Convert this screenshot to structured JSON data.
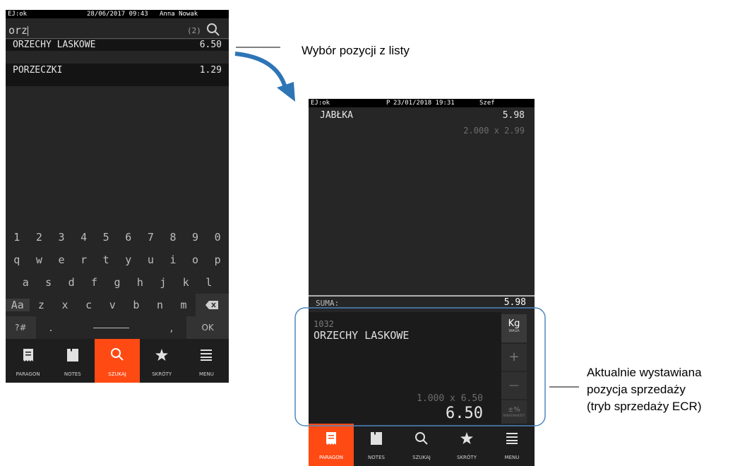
{
  "screen1": {
    "status": {
      "left": "EJ:ok",
      "datetime": "28/06/2017 09:43",
      "user": "Anna Nowak"
    },
    "search": {
      "value": "orz",
      "count": "(2)"
    },
    "results": [
      {
        "name": "ORZECHY LASKOWE",
        "price": "6.50"
      },
      {
        "name": "PORZECZKI",
        "price": "1.29"
      }
    ],
    "keyboard": {
      "row1": [
        "1",
        "2",
        "3",
        "4",
        "5",
        "6",
        "7",
        "8",
        "9",
        "0"
      ],
      "row2": [
        "q",
        "w",
        "e",
        "r",
        "t",
        "y",
        "u",
        "i",
        "o",
        "p"
      ],
      "row3": [
        "a",
        "s",
        "d",
        "f",
        "g",
        "h",
        "j",
        "k",
        "l"
      ],
      "row4": [
        "Aa",
        "z",
        "x",
        "c",
        "v",
        "b",
        "n",
        "m"
      ],
      "row5": {
        "sym": "?#",
        "dot": ".",
        "comma": ",",
        "ok": "OK"
      }
    },
    "nav": [
      "PARAGON",
      "NOTES",
      "SZUKAJ",
      "SKRÓTY",
      "MENU"
    ],
    "active_tab": "SZUKAJ"
  },
  "screen2": {
    "status": {
      "left": "EJ:ok",
      "mode": "P",
      "datetime": "23/01/2018 19:31",
      "user": "Szef"
    },
    "receipt": {
      "item": "JABŁKA",
      "price": "5.98",
      "qty_line": "2.000 x 2.99"
    },
    "sum": {
      "label": "SUMA:",
      "value": "5.98"
    },
    "current": {
      "code": "1032",
      "name": "ORZECHY LASKOWE",
      "qty_line": "1.000 x 6.50",
      "total": "6.50"
    },
    "side": {
      "kg": "Kg",
      "waga": "WAGA",
      "plus": "+",
      "minus": "—",
      "pct": "±%",
      "rabat": "RABAT/NARZUT"
    },
    "nav": [
      "PARAGON",
      "NOTES",
      "SZUKAJ",
      "SKRÓTY",
      "MENU"
    ],
    "active_tab": "PARAGON"
  },
  "annotations": {
    "top": "Wybór pozycji z listy",
    "bottom": [
      "Aktualnie wystawiana",
      "pozycja sprzedaży",
      "(tryb sprzedaży ECR)"
    ]
  },
  "colors": {
    "accent": "#ff4a14",
    "screen_bg": "#262626",
    "arrow": "#2e75b6",
    "frame": "#4e87c0"
  }
}
